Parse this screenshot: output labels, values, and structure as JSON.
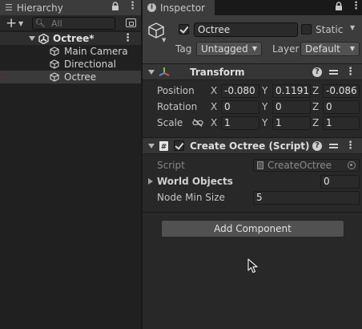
{
  "hierarchy": {
    "tab_title": "Hierarchy",
    "search_placeholder": "All",
    "scene_name": "Octree*",
    "items": [
      {
        "label": "Main Camera"
      },
      {
        "label": "Directional Light"
      },
      {
        "label": "Octree"
      }
    ]
  },
  "inspector": {
    "tab_title": "Inspector",
    "object_name": "Octree",
    "active": true,
    "static_label": "Static",
    "static_checked": false,
    "tag_label": "Tag",
    "tag_value": "Untagged",
    "layer_label": "Layer",
    "layer_value": "Default",
    "transform": {
      "title": "Transform",
      "position_label": "Position",
      "rotation_label": "Rotation",
      "scale_label": "Scale",
      "axis_x": "X",
      "axis_y": "Y",
      "axis_z": "Z",
      "position": {
        "x": "-0.080",
        "y": "0.11913",
        "z": "-0.086"
      },
      "rotation": {
        "x": "0",
        "y": "0",
        "z": "0"
      },
      "scale": {
        "x": "1",
        "y": "1",
        "z": "1"
      }
    },
    "script_component": {
      "title": "Create Octree (Script)",
      "enabled": true,
      "script_label": "Script",
      "script_value": "CreateOctree",
      "world_objects_label": "World Objects",
      "world_objects_count": "0",
      "node_min_size_label": "Node Min Size",
      "node_min_size_value": "5"
    },
    "add_component_label": "Add Component"
  },
  "colors": {
    "panel_bg": "#282828",
    "hierarchy_bg": "#202020",
    "header_bg": "#3c3c3c",
    "field_bg": "#2a2a2a",
    "button_bg": "#515151",
    "transform_icon_red": "#d9534f",
    "transform_icon_green": "#7cc043",
    "transform_icon_blue": "#4a8fe0"
  },
  "icons": {
    "hierarchy_tab": "list-icon",
    "inspector_tab": "info-icon",
    "scene": "unity-logo-icon",
    "gameobject": "cube-icon",
    "transform": "transform-axes-icon",
    "script": "script-icon"
  }
}
